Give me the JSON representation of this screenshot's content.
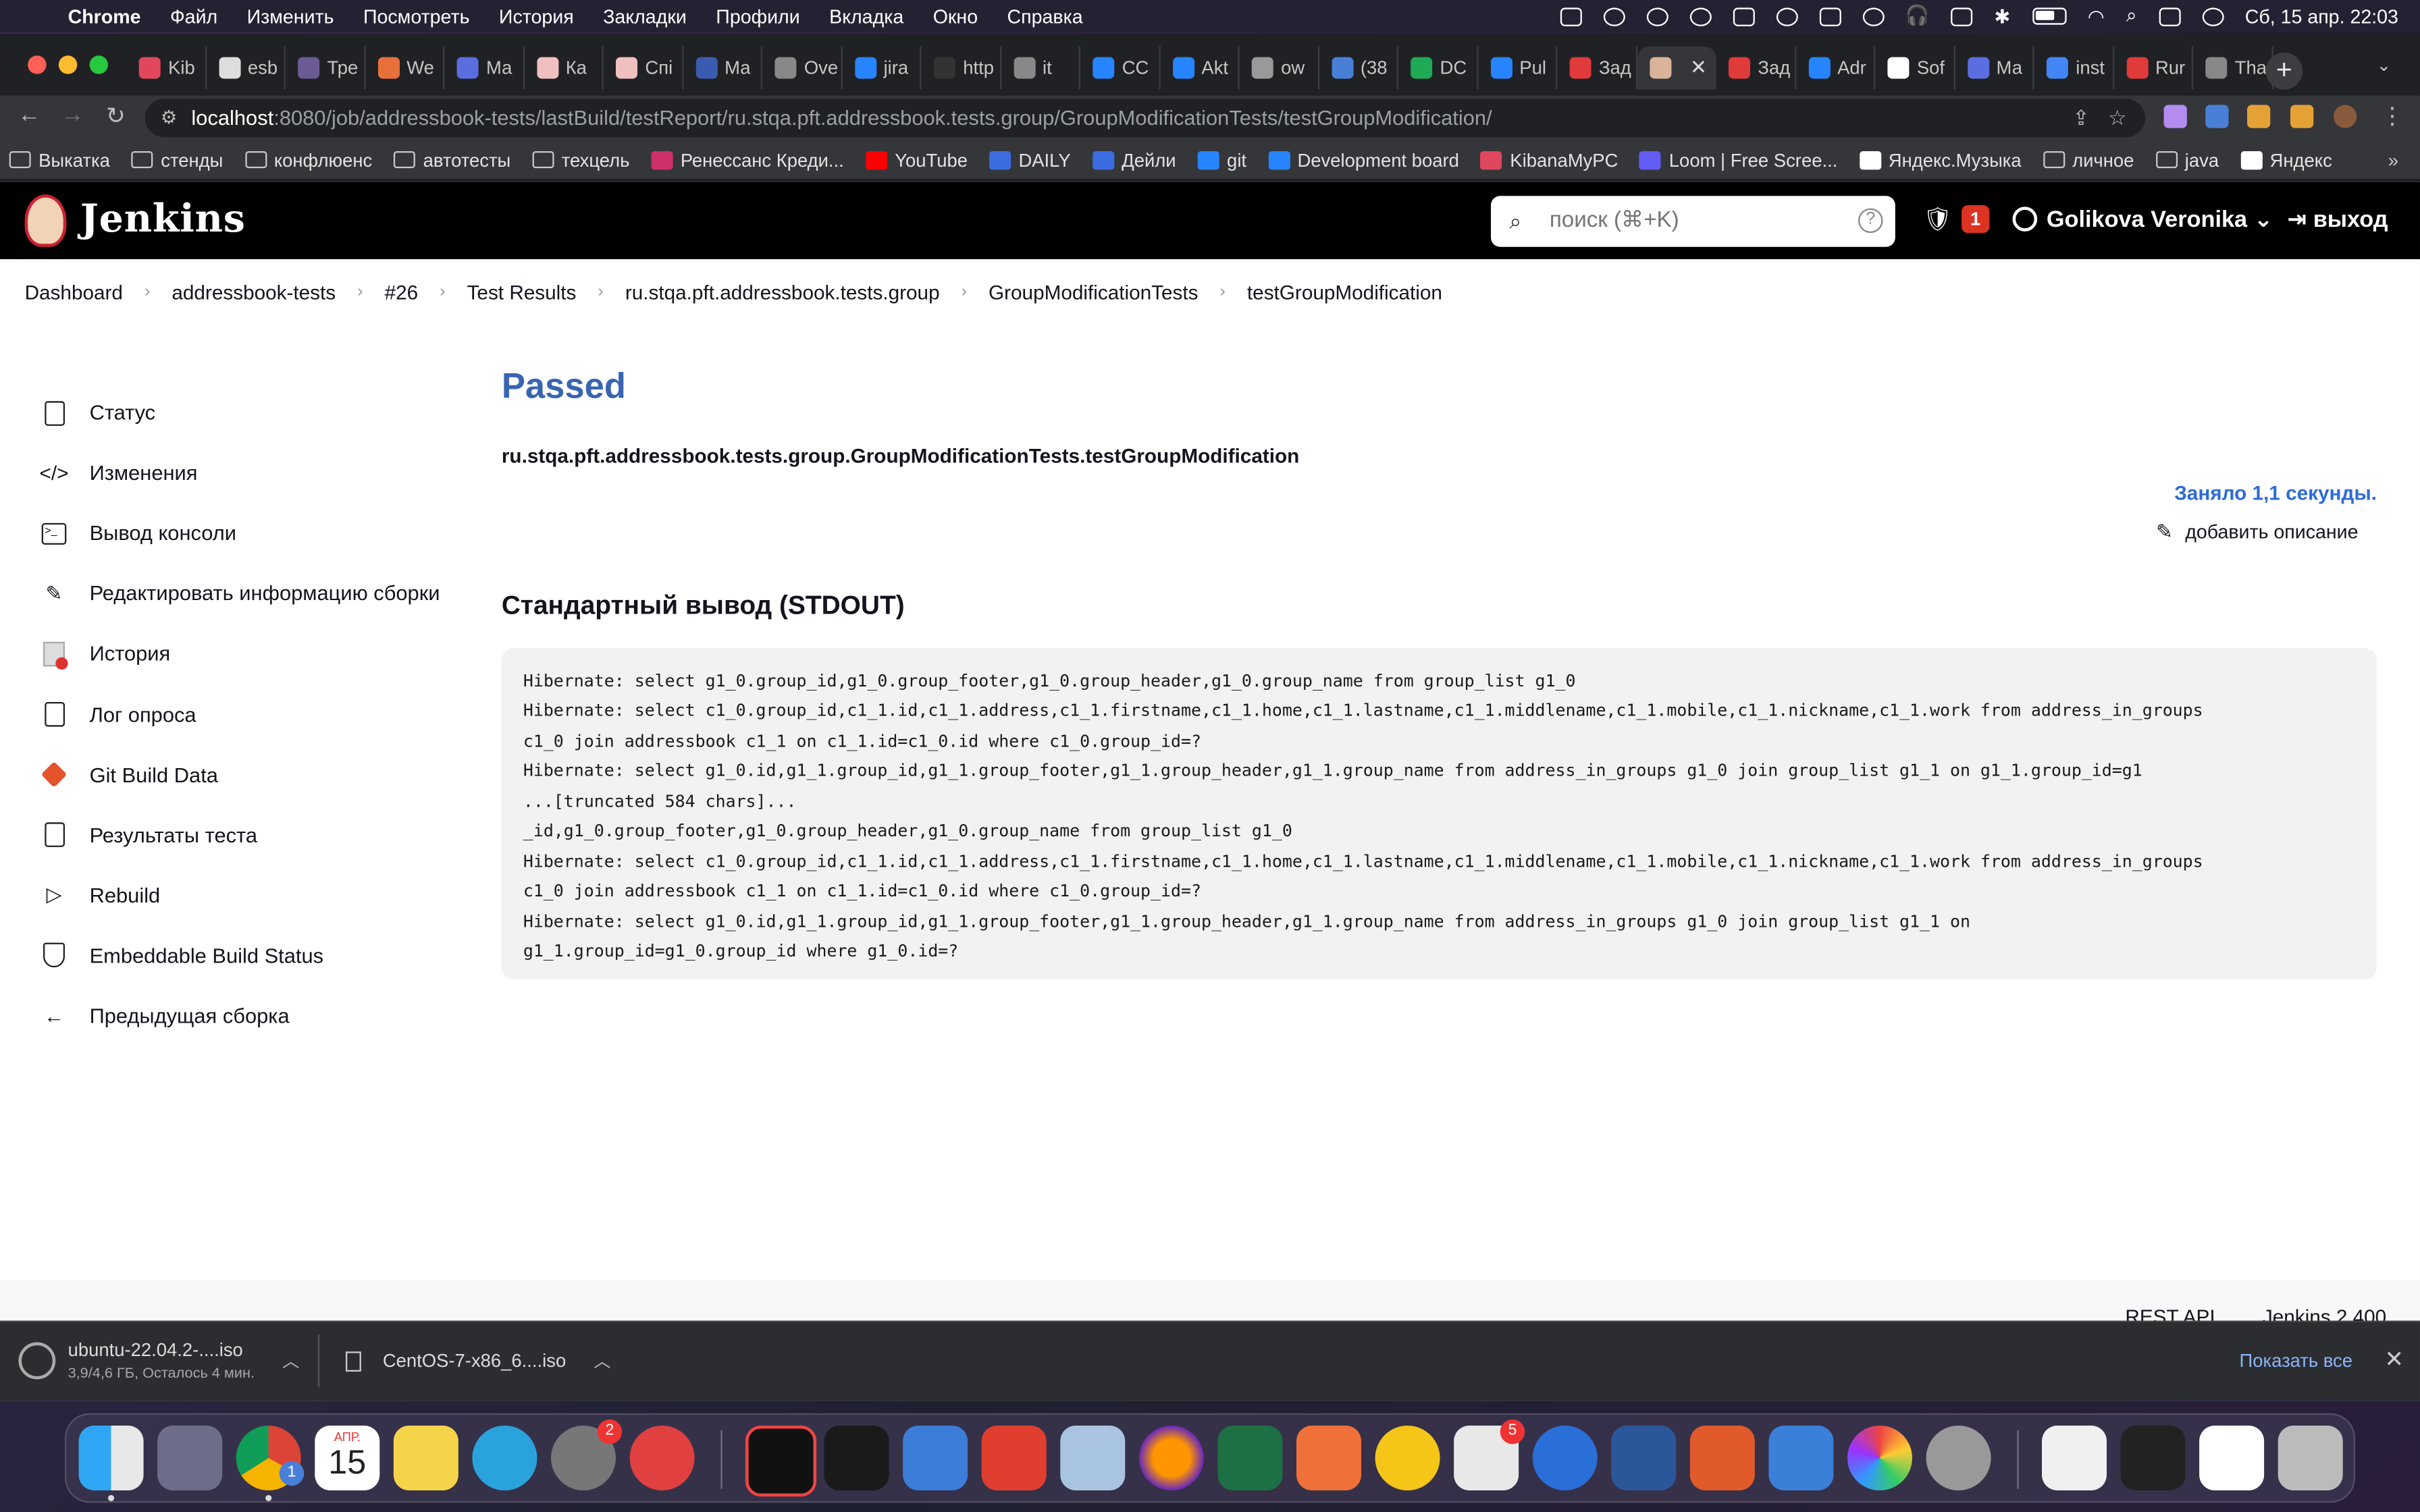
{
  "menubar": {
    "app": "Chrome",
    "items": [
      "Файл",
      "Изменить",
      "Посмотреть",
      "История",
      "Закладки",
      "Профили",
      "Вкладка",
      "Окно",
      "Справка"
    ],
    "datetime": "Сб, 15 апр.  22:03"
  },
  "tabs": [
    {
      "label": "Kib",
      "color": "#e0475d"
    },
    {
      "label": "esb",
      "color": "#dddddd"
    },
    {
      "label": "Тре",
      "color": "#6b5b95"
    },
    {
      "label": "We",
      "color": "#e8703a"
    },
    {
      "label": "Ма",
      "color": "#5a6ee0"
    },
    {
      "label": "Ка",
      "color": "#f0c0c0"
    },
    {
      "label": "Спі",
      "color": "#f0c0c0"
    },
    {
      "label": "Ма",
      "color": "#3b5bb0"
    },
    {
      "label": "Ove",
      "color": "#888888"
    },
    {
      "label": "jira",
      "color": "#2684ff"
    },
    {
      "label": "http",
      "color": "#333333"
    },
    {
      "label": "it",
      "color": "#888888"
    },
    {
      "label": "CC",
      "color": "#2684ff"
    },
    {
      "label": "Akt",
      "color": "#2684ff"
    },
    {
      "label": "ow",
      "color": "#999999"
    },
    {
      "label": "(38",
      "color": "#4a7fd8"
    },
    {
      "label": "DC",
      "color": "#1faa55"
    },
    {
      "label": "Pul",
      "color": "#2684ff"
    },
    {
      "label": "Зад",
      "color": "#e03a3a"
    },
    {
      "label": "",
      "color": "#d9b49a",
      "active": true
    },
    {
      "label": "Зад",
      "color": "#e03a3a"
    },
    {
      "label": "Adr",
      "color": "#2684ff"
    },
    {
      "label": "Sof",
      "color": "#ffffff"
    },
    {
      "label": "Ма",
      "color": "#5a6ee0"
    },
    {
      "label": "inst",
      "color": "#4285f4"
    },
    {
      "label": "Rur",
      "color": "#e03a3a"
    },
    {
      "label": "Tha",
      "color": "#888888"
    }
  ],
  "url": {
    "host": "localhost",
    "path": ":8080/job/addressbook-tests/lastBuild/testReport/ru.stqa.pft.addressbook.tests.group/GroupModificationTests/testGroupModification/"
  },
  "bookmarks": [
    {
      "label": "Выкатка",
      "type": "folder"
    },
    {
      "label": "стенды",
      "type": "folder"
    },
    {
      "label": "конфлюенс",
      "type": "folder"
    },
    {
      "label": "автотесты",
      "type": "folder"
    },
    {
      "label": "техцель",
      "type": "folder"
    },
    {
      "label": "Ренессанс Креди...",
      "type": "link",
      "color": "#d0306a"
    },
    {
      "label": "YouTube",
      "type": "link",
      "color": "#ff0000"
    },
    {
      "label": "DAILY",
      "type": "link",
      "color": "#3b6de0"
    },
    {
      "label": "Дейли",
      "type": "link",
      "color": "#3b6de0"
    },
    {
      "label": "git",
      "type": "link",
      "color": "#2684ff"
    },
    {
      "label": "Development board",
      "type": "link",
      "color": "#2684ff"
    },
    {
      "label": "KibanaMyPC",
      "type": "link",
      "color": "#e0475d"
    },
    {
      "label": "Loom | Free Scree...",
      "type": "link",
      "color": "#625df5"
    },
    {
      "label": "Яндекс.Музыка",
      "type": "link",
      "color": "#ffffff"
    },
    {
      "label": "личное",
      "type": "folder"
    },
    {
      "label": "java",
      "type": "folder"
    },
    {
      "label": "Яндекс",
      "type": "link",
      "color": "#ffffff"
    }
  ],
  "jenkins": {
    "title": "Jenkins",
    "search_placeholder": "поиск (⌘+K)",
    "security_count": "1",
    "user": "Golikova Veronika",
    "logout": "выход"
  },
  "breadcrumbs": [
    "Dashboard",
    "addressbook-tests",
    "#26",
    "Test Results",
    "ru.stqa.pft.addressbook.tests.group",
    "GroupModificationTests",
    "testGroupModification"
  ],
  "sidebar": [
    {
      "label": "Статус",
      "icon": "document-icon"
    },
    {
      "label": "Изменения",
      "icon": "code-icon"
    },
    {
      "label": "Вывод консоли",
      "icon": "terminal-icon"
    },
    {
      "label": "Редактировать информацию сборки",
      "icon": "edit-icon"
    },
    {
      "label": "История",
      "icon": "history-icon"
    },
    {
      "label": "Лог опроса",
      "icon": "clipboard-icon"
    },
    {
      "label": "Git Build Data",
      "icon": "git-icon"
    },
    {
      "label": "Результаты теста",
      "icon": "clipboard-icon"
    },
    {
      "label": "Rebuild",
      "icon": "play-icon"
    },
    {
      "label": "Embeddable Build Status",
      "icon": "shield-icon"
    },
    {
      "label": "Предыдущая сборка",
      "icon": "arrow-left-icon"
    }
  ],
  "result": {
    "status": "Passed",
    "test_name": "ru.stqa.pft.addressbook.tests.group.GroupModificationTests.testGroupModification",
    "duration": "Заняло 1,1 секунды.",
    "add_description": "добавить описание",
    "stdout_title": "Стандартный вывод (STDOUT)",
    "stdout": "Hibernate: select g1_0.group_id,g1_0.group_footer,g1_0.group_header,g1_0.group_name from group_list g1_0\nHibernate: select c1_0.group_id,c1_1.id,c1_1.address,c1_1.firstname,c1_1.home,c1_1.lastname,c1_1.middlename,c1_1.mobile,c1_1.nickname,c1_1.work from address_in_groups\nc1_0 join addressbook c1_1 on c1_1.id=c1_0.id where c1_0.group_id=?\nHibernate: select g1_0.id,g1_1.group_id,g1_1.group_footer,g1_1.group_header,g1_1.group_name from address_in_groups g1_0 join group_list g1_1 on g1_1.group_id=g1\n...[truncated 584 chars]...\n_id,g1_0.group_footer,g1_0.group_header,g1_0.group_name from group_list g1_0\nHibernate: select c1_0.group_id,c1_1.id,c1_1.address,c1_1.firstname,c1_1.home,c1_1.lastname,c1_1.middlename,c1_1.mobile,c1_1.nickname,c1_1.work from address_in_groups\nc1_0 join addressbook c1_1 on c1_1.id=c1_0.id where c1_0.group_id=?\nHibernate: select g1_0.id,g1_1.group_id,g1_1.group_footer,g1_1.group_header,g1_1.group_name from address_in_groups g1_0 join group_list g1_1 on\ng1_1.group_id=g1_0.group_id where g1_0.id=?"
  },
  "footer": {
    "rest_api": "REST API",
    "version": "Jenkins 2.400"
  },
  "downloads": {
    "items": [
      {
        "name": "ubuntu-22.04.2-....iso",
        "progress": "3,9/4,6 ГБ, Осталось 4 мин."
      },
      {
        "name": "CentOS-7-x86_6....iso"
      }
    ],
    "show_all": "Показать все"
  },
  "dock": {
    "calendar_month": "АПР.",
    "calendar_day": "15",
    "badges": {
      "chrome": "1",
      "settings": "2",
      "store": "5"
    }
  }
}
